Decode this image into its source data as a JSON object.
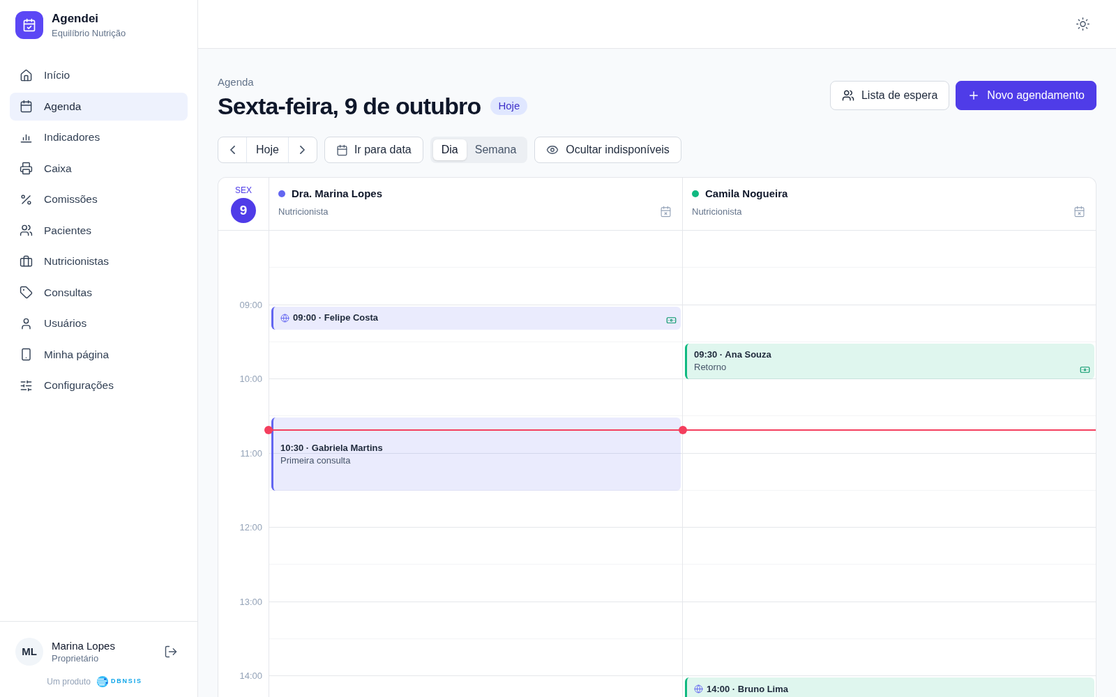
{
  "sidebar": {
    "brand": {
      "name": "Agendei",
      "subtitle": "Equilíbrio Nutrição"
    },
    "nav": [
      {
        "label": "Início",
        "selected": false
      },
      {
        "label": "Agenda",
        "selected": true
      },
      {
        "label": "Indicadores",
        "selected": false
      },
      {
        "label": "Caixa",
        "selected": false
      },
      {
        "label": "Comissões",
        "selected": false
      },
      {
        "label": "Pacientes",
        "selected": false
      },
      {
        "label": "Nutricionistas",
        "selected": false
      },
      {
        "label": "Consultas",
        "selected": false
      },
      {
        "label": "Usuários",
        "selected": false
      },
      {
        "label": "Minha página",
        "selected": false
      },
      {
        "label": "Configurações",
        "selected": false
      }
    ],
    "user": {
      "initials": "ML",
      "name": "Marina Lopes",
      "role": "Proprietário"
    },
    "footer": {
      "text": "Um produto",
      "brand": "DBNSIS"
    }
  },
  "header": {
    "breadcrumb": "Agenda",
    "title": "Sexta-feira, 9 de outubro",
    "badge": "Hoje",
    "actions": [
      {
        "label": "Lista de espera",
        "kind": "secondary"
      },
      {
        "label": "Novo agendamento",
        "kind": "primary"
      }
    ]
  },
  "toolbar": {
    "today": "Hoje",
    "go_to_date": "Ir para data",
    "views": [
      {
        "label": "Dia",
        "selected": true
      },
      {
        "label": "Semana",
        "selected": false
      }
    ],
    "hide_unavailable": "Ocultar indisponíveis"
  },
  "calendar": {
    "day": {
      "weekday": "SEX",
      "number": "9"
    },
    "hours": [
      "09:00",
      "10:00",
      "11:00",
      "12:00",
      "13:00",
      "14:00"
    ],
    "now_line": true,
    "columns": [
      {
        "name": "Dra. Marina Lopes",
        "role": "Nutricionista",
        "color": "#6366f1",
        "events": [
          {
            "title": "09:00 · Felipe Costa",
            "kind": "short",
            "online": true,
            "paid": true
          },
          {
            "title": "10:30 · Gabriela Martins",
            "subtitle": "Primeira consulta",
            "kind": "hour",
            "online": false,
            "paid": false
          }
        ]
      },
      {
        "name": "Camila Nogueira",
        "role": "Nutricionista",
        "color": "#10b981",
        "events": [
          {
            "title": "09:30 · Ana Souza",
            "subtitle": "Retorno",
            "kind": "half",
            "online": false,
            "paid": true
          },
          {
            "title": "14:00 · Bruno Lima",
            "kind": "short",
            "online": true,
            "paid": false
          }
        ]
      }
    ]
  }
}
